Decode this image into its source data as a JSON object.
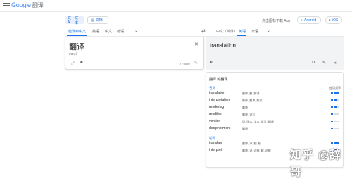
{
  "header": {
    "logo_google": "Google",
    "logo_translate": "翻译",
    "mode_text": "文本",
    "mode_doc": "文档",
    "promo": "点击图标下载 App",
    "android": "Android",
    "ios": "iOS"
  },
  "source_langs": [
    "检测到中文",
    "英语",
    "中文",
    "德语"
  ],
  "target_langs": [
    "中文（简体）",
    "英语",
    "日语"
  ],
  "source": {
    "text": "翻译",
    "transliteration": "Fānyì",
    "char_count": "2 / 5000"
  },
  "target": {
    "text": "translation"
  },
  "dictionary": {
    "title": "翻译 的翻译",
    "frequency_label": "使用频率",
    "noun": {
      "label": "名词",
      "rows": [
        {
          "word": "translation",
          "back": "翻译, 翻, 解译",
          "freq": 3
        },
        {
          "word": "interpretation",
          "back": "解释, 翻译, 解读",
          "freq": 2
        },
        {
          "word": "rendering",
          "back": "翻译",
          "freq": 2
        },
        {
          "word": "rendition",
          "back": "翻译, 译写",
          "freq": 1
        },
        {
          "word": "version",
          "back": "版, 版本, 文本, 说法, 翻译",
          "freq": 1
        },
        {
          "word": "decipherment",
          "back": "翻译",
          "freq": 1
        }
      ]
    },
    "verb": {
      "label": "动词",
      "rows": [
        {
          "word": "translate",
          "back": "翻译, 译, 翻, 繙",
          "freq": 3
        },
        {
          "word": "interpret",
          "back": "翻译, 译, 诠释, 解, 讲解",
          "freq": 2
        }
      ]
    }
  },
  "watermark": "知乎 @辞哥",
  "colors": {
    "accent": "#1a73e8",
    "active_bg": "#e8f0fe",
    "target_bg": "#f1f3f4"
  }
}
